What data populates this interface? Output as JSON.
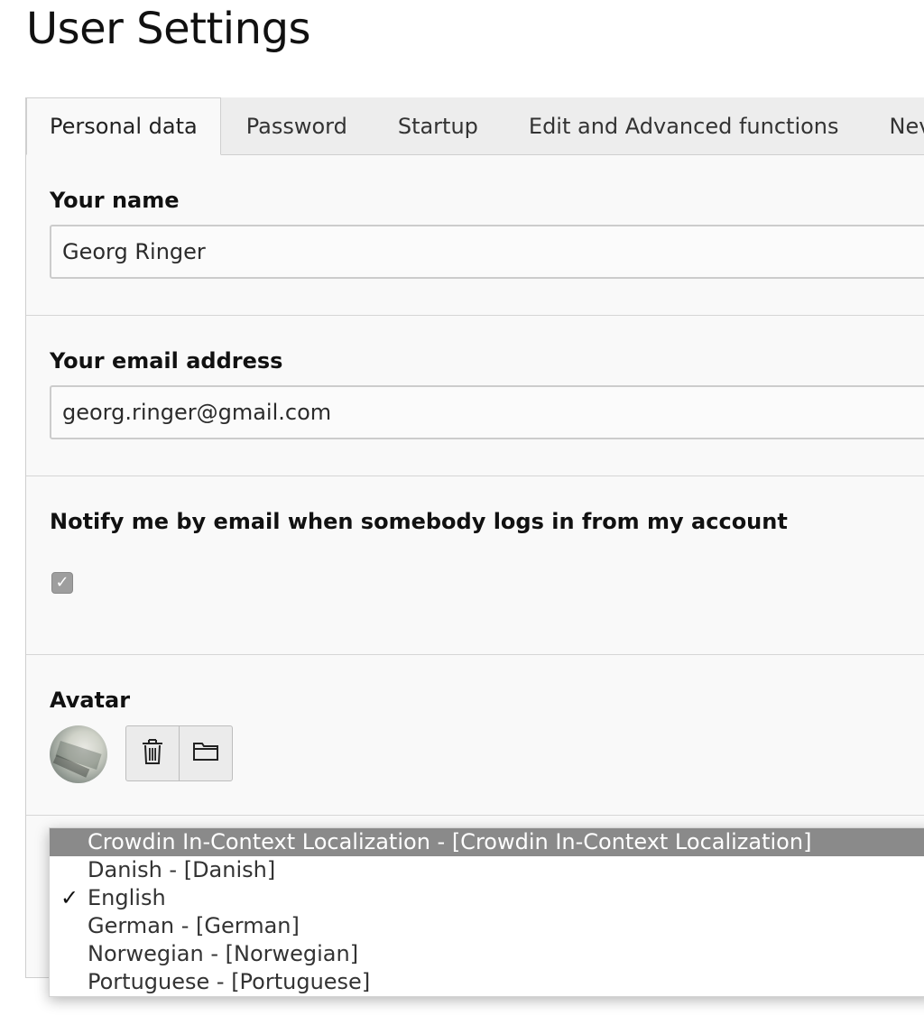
{
  "page": {
    "title": "User Settings"
  },
  "tabs": [
    {
      "label": "Personal data",
      "active": true
    },
    {
      "label": "Password",
      "active": false
    },
    {
      "label": "Startup",
      "active": false
    },
    {
      "label": "Edit and Advanced functions",
      "active": false
    },
    {
      "label": "Nev",
      "active": false
    }
  ],
  "fields": {
    "name": {
      "label": "Your name",
      "value": "Georg Ringer"
    },
    "email": {
      "label": "Your email address",
      "value": "georg.ringer@gmail.com"
    },
    "notify": {
      "label": "Notify me by email when somebody logs in from my account",
      "checked": true,
      "check_glyph": "✓"
    },
    "avatar": {
      "label": "Avatar"
    }
  },
  "icons": {
    "delete": "trash-icon",
    "select": "folder-icon"
  },
  "language_dropdown": {
    "selected": "English",
    "check_glyph": "✓",
    "options": [
      {
        "label": "Crowdin In-Context Localization - [Crowdin In-Context Localization]",
        "highlighted": true,
        "checked": false
      },
      {
        "label": "Danish - [Danish]",
        "highlighted": false,
        "checked": false
      },
      {
        "label": "English",
        "highlighted": false,
        "checked": true
      },
      {
        "label": "German - [German]",
        "highlighted": false,
        "checked": false
      },
      {
        "label": "Norwegian - [Norwegian]",
        "highlighted": false,
        "checked": false
      },
      {
        "label": "Portuguese - [Portuguese]",
        "highlighted": false,
        "checked": false
      }
    ]
  },
  "colors": {
    "highlight": "#8a8a8a",
    "panel_bg": "#f9f9f9",
    "tab_bar_bg": "#ededed"
  }
}
